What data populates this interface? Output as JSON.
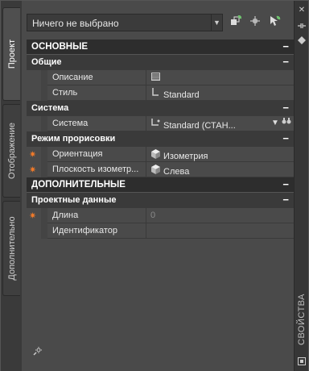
{
  "tabs": [
    "Проект",
    "Отображение",
    "Дополнительно"
  ],
  "palette_title": "СВОЙСТВА",
  "selection": {
    "value": "Ничего не выбрано"
  },
  "sections": {
    "basic": "ОСНОВНЫЕ",
    "general": "Общие",
    "system": "Система",
    "draw_mode": "Режим прорисовки",
    "extra": "ДОПОЛНИТЕЛЬНЫЕ",
    "project_data": "Проектные данные"
  },
  "toggle_symbol": "−",
  "props": {
    "description": {
      "name": "Описание",
      "value": ""
    },
    "style": {
      "name": "Стиль",
      "value": "Standard"
    },
    "system": {
      "name": "Система",
      "value": "Standard (СТАН..."
    },
    "orientation": {
      "name": "Ориентация",
      "value": "Изометрия"
    },
    "iso_plane": {
      "name": "Плоскость изометр...",
      "value": "Слева"
    },
    "length": {
      "name": "Длина",
      "value": "0"
    },
    "identifier": {
      "name": "Идентификатор",
      "value": ""
    }
  },
  "icons": [
    "quick-select-icon",
    "select-objects-icon",
    "toggle-pickadd-icon",
    "close-icon",
    "auto-hide-icon",
    "properties-menu-icon",
    "grip-icon",
    "required-star-icon",
    "cube-icon",
    "binoculars-icon",
    "settings-icon"
  ],
  "colors": {
    "required_star": "#f07a2a",
    "category_dark": "#2d2d2d",
    "panel": "#4a4a4a"
  }
}
